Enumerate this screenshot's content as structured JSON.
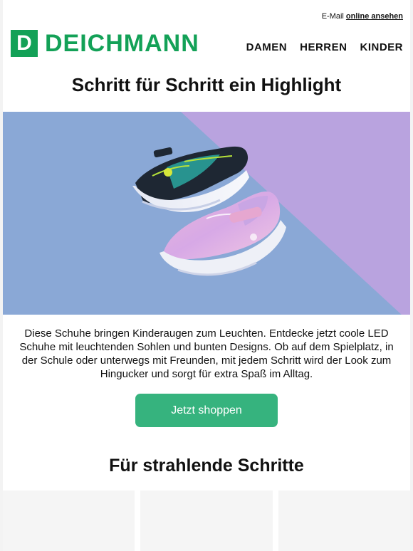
{
  "preheader": {
    "text": "E-Mail",
    "link": "online ansehen"
  },
  "brand": {
    "logo_letter": "D",
    "name": "DEICHMANN",
    "color": "#13a157"
  },
  "nav": {
    "items": [
      "DAMEN",
      "HERREN",
      "KINDER"
    ]
  },
  "headline": "Schritt für Schritt ein Highlight",
  "body_text": "Diese Schuhe bringen Kinderaugen zum Leuchten. Entdecke jetzt coole LED Schuhe mit leuchtenden Sohlen und bunten Designs. Ob auf dem Spielplatz, in der Schule oder unterwegs mit Freunden, mit jedem Schritt wird der Look zum Hingucker und sorgt für extra Spaß im Alltag.",
  "cta": {
    "label": "Jetzt shoppen",
    "color": "#36b37e"
  },
  "subhead": "Für strahlende Schritte"
}
